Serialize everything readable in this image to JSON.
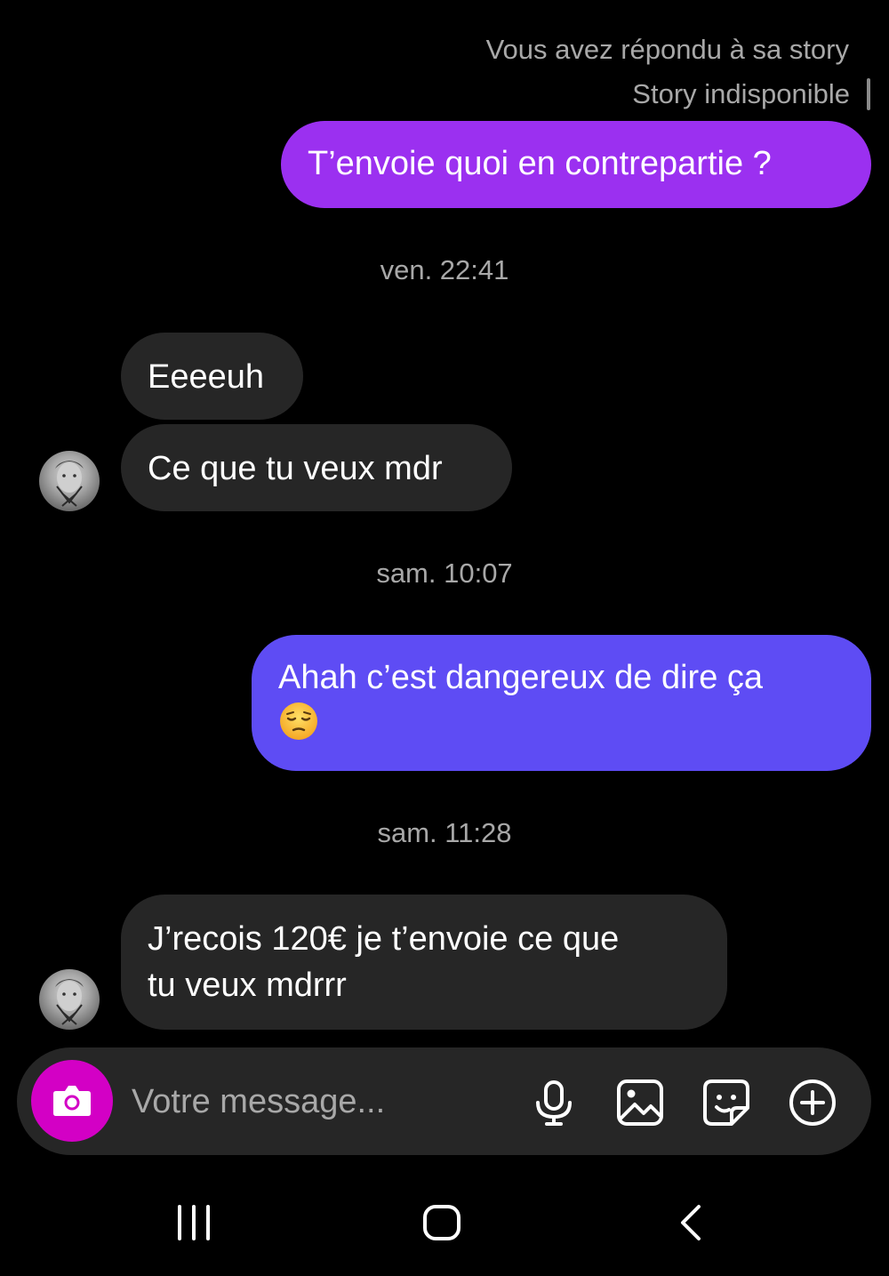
{
  "story": {
    "replied_text": "Vous avez répondu à sa story",
    "unavailable_text": "Story indisponible"
  },
  "messages": [
    {
      "text": "T’envoie quoi en contrepartie ?",
      "from": "me",
      "color": "#9b30f0"
    },
    {
      "text": "Eeeeuh",
      "from": "them"
    },
    {
      "text": "Ce que tu veux mdr",
      "from": "them"
    },
    {
      "text": "Ahah c’est dangereux de dire ça",
      "emoji": "pensive-face-emoji",
      "from": "me",
      "color": "#5e4cf4"
    },
    {
      "text": "J’recois 120€ je t’envoie ce que\ntu veux mdrrr",
      "from": "them"
    }
  ],
  "timestamps": [
    "ven. 22:41",
    "sam. 10:07",
    "sam. 11:28"
  ],
  "composer": {
    "placeholder": "Votre message...",
    "camera_icon": "camera-icon",
    "camera_color": "#d300c5",
    "mic_icon": "microphone-icon",
    "gallery_icon": "image-icon",
    "sticker_icon": "sticker-icon",
    "plus_icon": "plus-circle-icon"
  },
  "nav_bar": {
    "recents_icon": "recent-apps-icon",
    "home_icon": "home-icon",
    "back_icon": "back-icon"
  },
  "colors": {
    "background": "#000000",
    "received_bubble": "#262626",
    "secondary_text": "#a8a8a8"
  }
}
